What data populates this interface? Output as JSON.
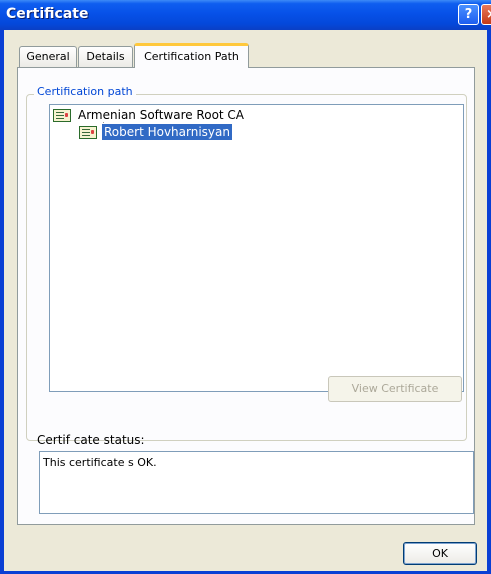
{
  "window": {
    "title": "Certificate",
    "help_glyph": "?",
    "close_glyph": "×"
  },
  "tabs": [
    {
      "label": "General",
      "active": false
    },
    {
      "label": "Details",
      "active": false
    },
    {
      "label": "Certification Path",
      "active": true
    }
  ],
  "certification_path": {
    "group_label": "Certification path",
    "nodes": [
      {
        "label": "Armenian Software Root CA",
        "icon": "certificate-icon",
        "selected": false
      },
      {
        "label": "Robert Hovharnisyan",
        "icon": "certificate-icon",
        "selected": true
      }
    ],
    "view_button_label": "View Certificate",
    "view_button_enabled": false
  },
  "status": {
    "label": "Certif cate status:",
    "text": "This certificate s OK."
  },
  "footer": {
    "ok_label": "OK"
  },
  "colors": {
    "titlebar": "#0751e8",
    "selection": "#316ac5",
    "active_tab_accent": "#ffc83c",
    "group_label": "#0046d5"
  }
}
